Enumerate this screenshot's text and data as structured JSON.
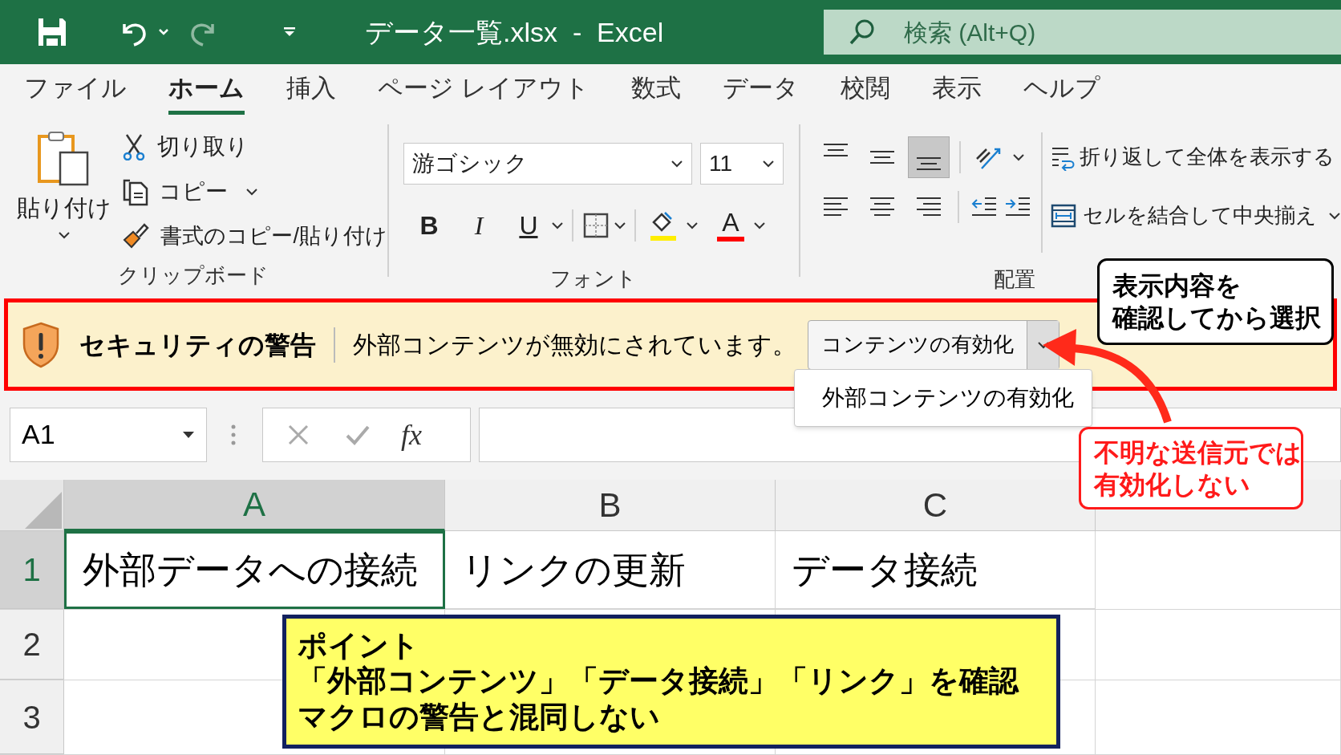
{
  "window": {
    "title": "データ一覧.xlsx  -  Excel",
    "search": {
      "placeholder": "検索 (Alt+Q)"
    }
  },
  "tabs": [
    {
      "label": "ファイル",
      "selected": false
    },
    {
      "label": "ホーム",
      "selected": true
    },
    {
      "label": "挿入",
      "selected": false
    },
    {
      "label": "ページ レイアウト",
      "selected": false
    },
    {
      "label": "数式",
      "selected": false
    },
    {
      "label": "データ",
      "selected": false
    },
    {
      "label": "校閲",
      "selected": false
    },
    {
      "label": "表示",
      "selected": false
    },
    {
      "label": "ヘルプ",
      "selected": false
    }
  ],
  "ribbon": {
    "clipboard": {
      "label": "クリップボード",
      "paste": "貼り付け",
      "cut": "切り取り",
      "copy": "コピー",
      "format_painter": "書式のコピー/貼り付け"
    },
    "font": {
      "label": "フォント",
      "font_name": "游ゴシック",
      "font_size": "11",
      "bold": "B",
      "italic": "I",
      "underline": "U",
      "font_color": "A"
    },
    "alignment": {
      "label": "配置",
      "vertical": [
        {
          "kind": "top",
          "selected": false
        },
        {
          "kind": "middle",
          "selected": false
        },
        {
          "kind": "bottom",
          "selected": true
        }
      ],
      "wrap_text": "折り返して全体を表示する",
      "merge_center": "セルを結合して中央揃え"
    }
  },
  "security_bar": {
    "title": "セキュリティの警告",
    "message": "外部コンテンツが無効にされています。",
    "button": "コンテンツの有効化",
    "menu_items": [
      "外部コンテンツの有効化"
    ]
  },
  "formula_bar": {
    "name_box": "A1",
    "fx": "fx"
  },
  "sheet": {
    "columns": [
      {
        "label": "A",
        "selected": true
      },
      {
        "label": "B",
        "selected": false
      },
      {
        "label": "C",
        "selected": false
      },
      {
        "selected": false
      }
    ],
    "rows": [
      {
        "number": "1",
        "selected": true,
        "cells": [
          {
            "text": "外部データへの接続",
            "selected": true
          },
          {
            "text": "リンクの更新",
            "selected": false
          },
          {
            "text": "データ接続",
            "selected": false
          }
        ]
      },
      {
        "number": "2",
        "selected": false,
        "cells": []
      },
      {
        "number": "3",
        "selected": false,
        "cells": []
      }
    ]
  },
  "annotations": {
    "check_callout": [
      "表示内容を",
      "確認してから選択"
    ],
    "warning_callout": [
      "不明な送信元では",
      "有効化しない"
    ],
    "point_box": [
      "ポイント",
      "「外部コンテンツ」「データ接続」「リンク」を確認",
      "マクロの警告と混同しない"
    ]
  }
}
